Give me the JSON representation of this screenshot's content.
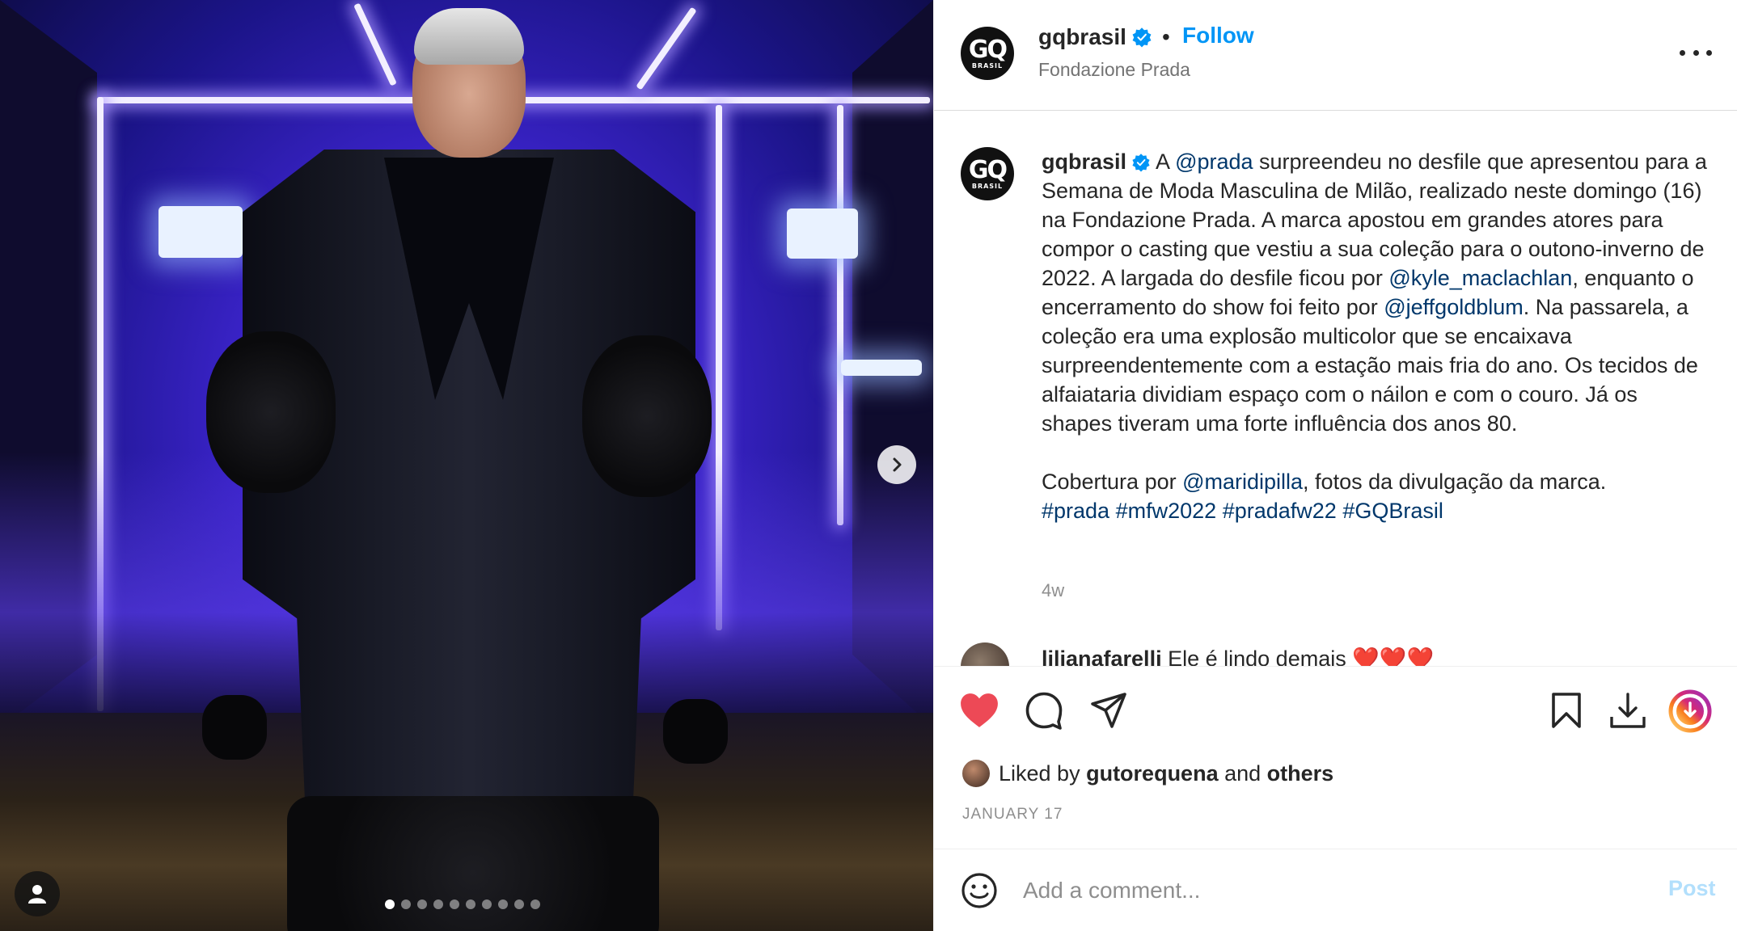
{
  "post": {
    "media": {
      "carousel_count": 10,
      "active_index": 0
    },
    "header": {
      "username": "gqbrasil",
      "separator": "•",
      "follow_label": "Follow",
      "location": "Fondazione Prada",
      "avatar_line1": "GQ",
      "avatar_line2": "BRASIL"
    },
    "caption": {
      "username": "gqbrasil",
      "p1_a": "A ",
      "mention_prada": "@prada",
      "p1_b": " surpreendeu no desfile que apresentou para a Semana de Moda Masculina de Milão, realizado neste domingo (16) na Fondazione Prada. A marca apostou em grandes atores para compor o casting que vestiu a sua coleção para o outono-inverno de 2022. A largada do desfile ficou por ",
      "mention_kyle": "@kyle_maclachlan",
      "p1_c": ", enquanto o encerramento do show foi feito por ",
      "mention_jeff": "@jeffgoldblum",
      "p1_d": ". Na passarela, a coleção era uma explosão multicolor que se encaixava surpreendentemente com a estação mais fria do ano. Os tecidos de alfaiataria dividiam espaço com o náilon e com o couro. Já os shapes tiveram uma forte influência dos anos 80.",
      "p2_a": "Cobertura por ",
      "mention_mari": "@maridipilla",
      "p2_b": ", fotos da divulgação da marca.",
      "hashtags": [
        "#prada",
        "#mfw2022",
        "#pradafw22",
        "#GQBrasil"
      ],
      "time_ago": "4w"
    },
    "first_comment": {
      "username": "lilianafarelli",
      "text": "Ele é lindo demais ❤️❤️❤️"
    },
    "likes": {
      "prefix": "Liked by ",
      "user": "gutorequena",
      "middle": " and ",
      "others": "others"
    },
    "date": "JANUARY 17",
    "comment_box": {
      "placeholder": "Add a comment...",
      "post_label": "Post"
    },
    "colors": {
      "heart": "#ed4956",
      "link": "#00376b",
      "follow": "#0095f6",
      "verified": "#0095f6",
      "post_disabled": "#b2dffc"
    }
  }
}
